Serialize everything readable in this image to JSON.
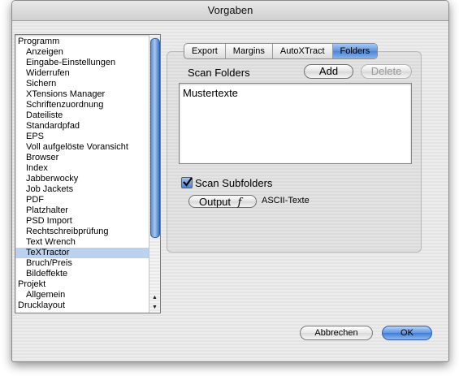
{
  "window": {
    "title": "Vorgaben"
  },
  "sidebar": {
    "items": [
      {
        "label": "Programm",
        "level": 0,
        "selected": false
      },
      {
        "label": "Anzeigen",
        "level": 1,
        "selected": false
      },
      {
        "label": "Eingabe-Einstellungen",
        "level": 1,
        "selected": false
      },
      {
        "label": "Widerrufen",
        "level": 1,
        "selected": false
      },
      {
        "label": "Sichern",
        "level": 1,
        "selected": false
      },
      {
        "label": "XTensions Manager",
        "level": 1,
        "selected": false
      },
      {
        "label": "Schriftenzuordnung",
        "level": 1,
        "selected": false
      },
      {
        "label": "Dateiliste",
        "level": 1,
        "selected": false
      },
      {
        "label": "Standardpfad",
        "level": 1,
        "selected": false
      },
      {
        "label": "EPS",
        "level": 1,
        "selected": false
      },
      {
        "label": "Voll aufgelöste Voransicht",
        "level": 1,
        "selected": false
      },
      {
        "label": "Browser",
        "level": 1,
        "selected": false
      },
      {
        "label": "Index",
        "level": 1,
        "selected": false
      },
      {
        "label": "Jabberwocky",
        "level": 1,
        "selected": false
      },
      {
        "label": "Job Jackets",
        "level": 1,
        "selected": false
      },
      {
        "label": "PDF",
        "level": 1,
        "selected": false
      },
      {
        "label": "Platzhalter",
        "level": 1,
        "selected": false
      },
      {
        "label": "PSD Import",
        "level": 1,
        "selected": false
      },
      {
        "label": "Rechtschreibprüfung",
        "level": 1,
        "selected": false
      },
      {
        "label": "Text Wrench",
        "level": 1,
        "selected": false
      },
      {
        "label": "TeXTractor",
        "level": 1,
        "selected": true
      },
      {
        "label": "Bruch/Preis",
        "level": 1,
        "selected": false
      },
      {
        "label": "Bildeffekte",
        "level": 1,
        "selected": false
      },
      {
        "label": "Projekt",
        "level": 0,
        "selected": false
      },
      {
        "label": "Allgemein",
        "level": 1,
        "selected": false
      },
      {
        "label": "Drucklayout",
        "level": 0,
        "selected": false
      }
    ]
  },
  "tabs": [
    {
      "label": "Export",
      "active": false
    },
    {
      "label": "Margins",
      "active": false
    },
    {
      "label": "AutoXTract",
      "active": false
    },
    {
      "label": "Folders",
      "active": true
    }
  ],
  "folders": {
    "heading": "Scan Folders",
    "add_label": "Add",
    "delete_label": "Delete",
    "items": [
      "Mustertexte"
    ],
    "subfolders_label": "Scan Subfolders",
    "subfolders_checked": true,
    "output_label": "Output",
    "output_icon": "f",
    "output_value": "ASCII-Texte"
  },
  "footer": {
    "cancel_label": "Abbrechen",
    "ok_label": "OK"
  },
  "colors": {
    "selection": "#bcd1ee",
    "accent": "#4a86d9"
  }
}
